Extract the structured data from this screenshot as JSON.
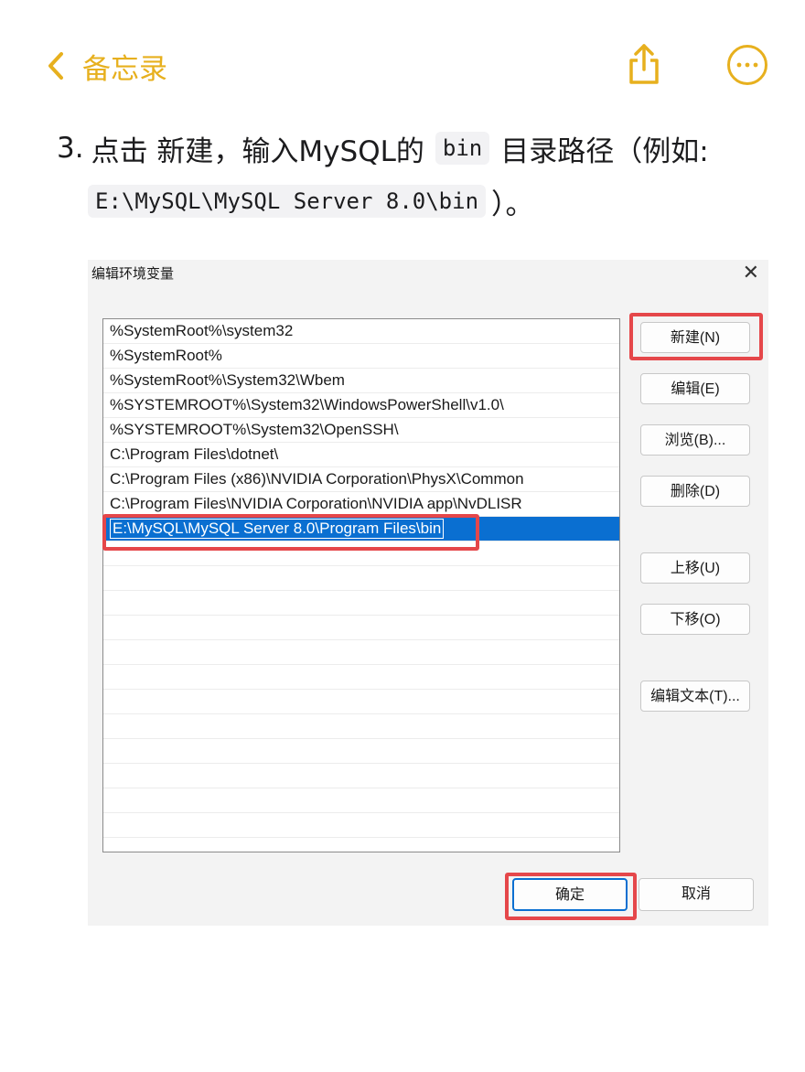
{
  "nav": {
    "back_label": "备忘录",
    "accent_color": "#e7b01e",
    "icons": [
      "chevron-left-icon",
      "share-icon",
      "more-icon"
    ]
  },
  "note": {
    "step_number": "3.",
    "step_text_before": "点击 新建，输入MySQL的",
    "step_code": "bin",
    "step_text_after": "目录路径（例如:",
    "path_code": "E:\\MySQL\\MySQL Server 8.0\\bin",
    "path_suffix": "）。"
  },
  "dialog": {
    "title": "编辑环境变量",
    "close_symbol": "✕",
    "paths": [
      "%SystemRoot%\\system32",
      "%SystemRoot%",
      "%SystemRoot%\\System32\\Wbem",
      "%SYSTEMROOT%\\System32\\WindowsPowerShell\\v1.0\\",
      "%SYSTEMROOT%\\System32\\OpenSSH\\",
      "C:\\Program Files\\dotnet\\",
      "C:\\Program Files (x86)\\NVIDIA Corporation\\PhysX\\Common",
      "C:\\Program Files\\NVIDIA Corporation\\NVIDIA app\\NvDLISR"
    ],
    "editing_value": "E:\\MySQL\\MySQL Server 8.0\\Program Files\\bin",
    "buttons": {
      "new": "新建(N)",
      "edit": "编辑(E)",
      "browse": "浏览(B)...",
      "delete": "删除(D)",
      "move_up": "上移(U)",
      "move_down": "下移(O)",
      "edit_text": "编辑文本(T)...",
      "ok": "确定",
      "cancel": "取消"
    },
    "highlight_color": "#e5474a",
    "selection_color": "#0a6fd1"
  }
}
